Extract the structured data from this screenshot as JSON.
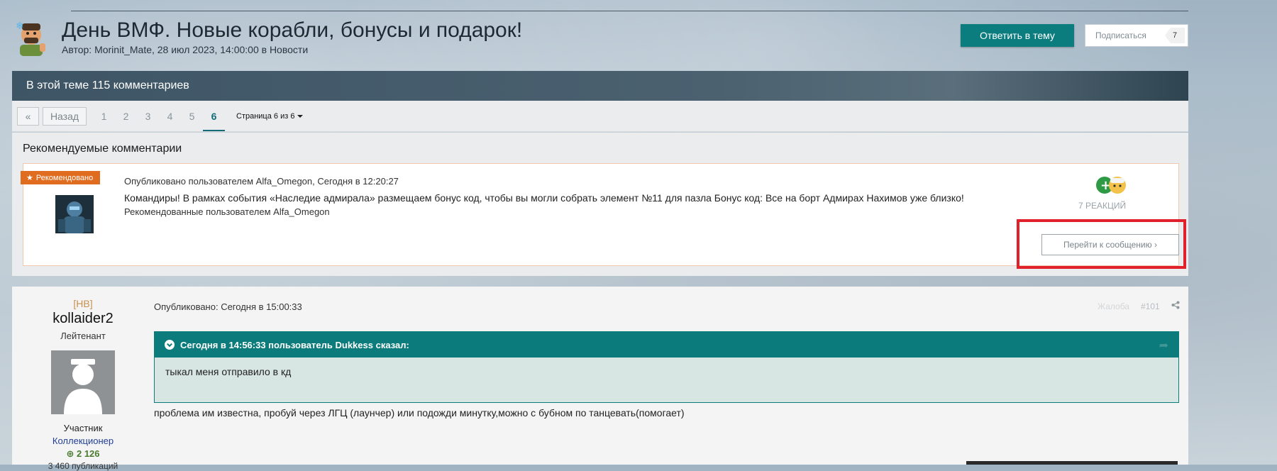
{
  "header": {
    "title": "День ВМФ. Новые корабли, бонусы и подарок!",
    "meta": "Автор: Morinit_Mate, 28 июл 2023, 14:00:00 в Новости",
    "reply_button": "Ответить в тему",
    "subscribe_button": "Подписаться",
    "subscribe_count": "7"
  },
  "comments_bar": {
    "label": "В этой теме 115 комментариев"
  },
  "pagination": {
    "first_symbol": "«",
    "back_label": "Назад",
    "pages": [
      "1",
      "2",
      "3",
      "4",
      "5",
      "6"
    ],
    "active_page": "6",
    "jump_label": "Страница 6 из 6"
  },
  "recommended": {
    "section_title": "Рекомендуемые комментарии",
    "badge": "Рекомендовано",
    "meta": "Опубликовано пользователем Alfa_Omegon, Сегодня в 12:20:27",
    "text": "Командиры!  В рамках события «Наследие адмирала» размещаем бонус код, чтобы вы могли собрать элемент №11 для пазла   Бонус код:   Все на борт Адмирах Нахимов уже близко!",
    "recommended_by": "Рекомендованные пользователем Alfa_Omegon",
    "reactions_label": "7 РЕАКЦИЙ",
    "goto_button": "Перейти к сообщению ›"
  },
  "post": {
    "user_tag": "[НВ]",
    "username": "kollaider2",
    "rank": "Лейтенант",
    "group": "Участник",
    "collector": "Коллекционер",
    "reputation": "2 126",
    "battles_partial": "3 460 публикаций",
    "meta": "Опубликовано: Сегодня в 15:00:33",
    "report_label": "Жалоба",
    "post_number": "#101",
    "quote_header": "Сегодня в 14:56:33 пользователь Dukkess сказал:",
    "quote_text": "тыкал меня отправило в кд",
    "body": "проблема им известна, пробуй через ЛГЦ (лаунчер) или подожди минутку,можно с бубном по танцевать(помогает)"
  },
  "colors": {
    "accent": "#0c7d7e",
    "badge": "#e06d1f",
    "highlight_frame": "#e0212c"
  }
}
